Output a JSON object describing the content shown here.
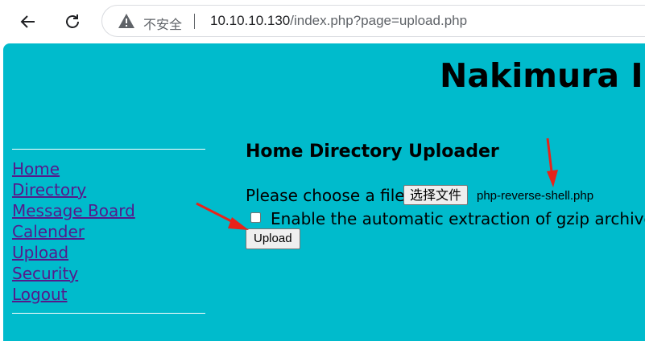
{
  "browser": {
    "back_icon": "back-arrow-icon",
    "reload_icon": "reload-icon",
    "security_icon": "warning-triangle-icon",
    "security_label": "不安全",
    "url_host": "10.10.10.130",
    "url_path": "/index.php?page=upload.php"
  },
  "site": {
    "title": "Nakimura Ind",
    "background_color": "#00bbcc"
  },
  "sidebar": {
    "items": [
      {
        "label": "Home"
      },
      {
        "label": "Directory"
      },
      {
        "label": "Message Board"
      },
      {
        "label": "Calender"
      },
      {
        "label": "Upload"
      },
      {
        "label": "Security"
      },
      {
        "label": "Logout"
      }
    ]
  },
  "uploader": {
    "title": "Home Directory Uploader",
    "choose_label": "Please choose a file:",
    "file_button_label": "选择文件",
    "selected_file": "php-reverse-shell.php",
    "gzip_label": "Enable the automatic extraction of gzip archives.",
    "gzip_checked": false,
    "upload_button_label": "Upload"
  },
  "annotations": {
    "arrow_color": "#e8231a"
  }
}
